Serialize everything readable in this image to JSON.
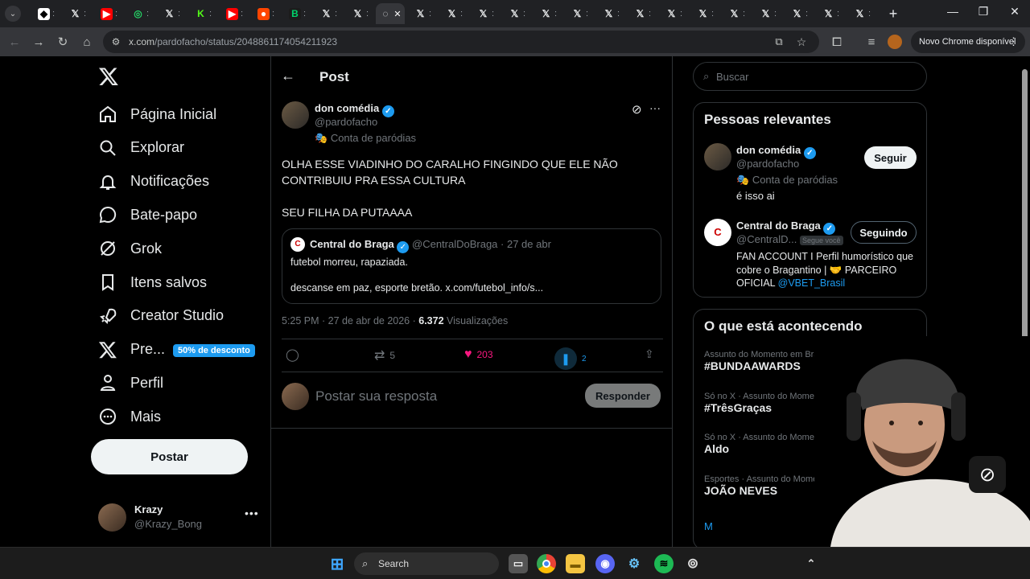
{
  "browser": {
    "url_host": "x.com",
    "url_path": "/pardofacho/status/2048861174054211923",
    "update_label": "Novo Chrome disponível"
  },
  "sidebar": {
    "items": [
      {
        "label": "Página Inicial",
        "icon": "home-icon"
      },
      {
        "label": "Explorar",
        "icon": "search-icon"
      },
      {
        "label": "Notificações",
        "icon": "bell-icon"
      },
      {
        "label": "Bate-papo",
        "icon": "chat-icon"
      },
      {
        "label": "Grok",
        "icon": "grok-icon"
      },
      {
        "label": "Itens salvos",
        "icon": "bookmark-icon"
      },
      {
        "label": "Creator Studio",
        "icon": "rocket-icon"
      },
      {
        "label": "Pre...",
        "icon": "x-logo-icon"
      },
      {
        "label": "Perfil",
        "icon": "person-icon"
      },
      {
        "label": "Mais",
        "icon": "more-circle-icon"
      }
    ],
    "premium_badge": "50% de desconto",
    "post_button": "Postar",
    "account": {
      "name": "Krazy",
      "handle": "@Krazy_Bong"
    }
  },
  "post": {
    "header_title": "Post",
    "author_name": "don comédia",
    "author_handle": "@pardofacho",
    "author_label": "Conta de paródias",
    "text_line1": "OLHA ESSE VIADINHO DO CARALHO FINGINDO QUE ELE NÃO",
    "text_line2": "CONTRIBUIU PRA ESSA CULTURA",
    "text_line3": "SEU FILHA DA PUTAAAA",
    "quote": {
      "name": "Central do Braga",
      "handle": "@CentralDoBraga",
      "date": "· 27 de abr",
      "line1": "futebol morreu, rapaziada.",
      "line2": "descanse em paz, esporte bretão. x.com/futebol_info/s..."
    },
    "timestamp": "5:25 PM · 27 de abr de 2026 · ",
    "views_count": "6.372",
    "views_label": " Visualizações",
    "reposts": "5",
    "likes": "203",
    "bookmarks": "2",
    "reply_placeholder": "Postar sua resposta",
    "reply_button": "Responder"
  },
  "right": {
    "search_placeholder": "Buscar",
    "relevant_title": "Pessoas relevantes",
    "people": [
      {
        "name": "don comédia",
        "handle": "@pardofacho",
        "label": "Conta de paródias",
        "bio": "é isso ai",
        "button": "Seguir"
      },
      {
        "name": "Central do Braga",
        "handle": "@CentralD...",
        "follows_you": "Segue você",
        "bio_line1": "FAN ACCOUNT I Perfil humorístico que",
        "bio_line2": "cobre o Bragantino | 🤝 PARCEIRO",
        "bio_line3_prefix": "OFICIAL ",
        "bio_link": "@VBET_Brasil",
        "button": "Seguindo"
      }
    ],
    "trends_title": "O que está acontecendo",
    "trends": [
      {
        "category": "Assunto do Momento em Brasil",
        "name": "#BUNDAAWARDS"
      },
      {
        "category": "Só no X · Assunto do Momento",
        "name": "#TrêsGraças"
      },
      {
        "category": "Só no X · Assunto do Momento",
        "name": "Aldo"
      },
      {
        "category": "Esportes · Assunto do Momento",
        "name": "JOÃO NEVES"
      }
    ],
    "show_more": "M"
  },
  "taskbar": {
    "search_label": "Search"
  },
  "colors": {
    "accent": "#1d9bf0",
    "like": "#f91880",
    "bg": "#000000",
    "border": "#2f3336"
  }
}
